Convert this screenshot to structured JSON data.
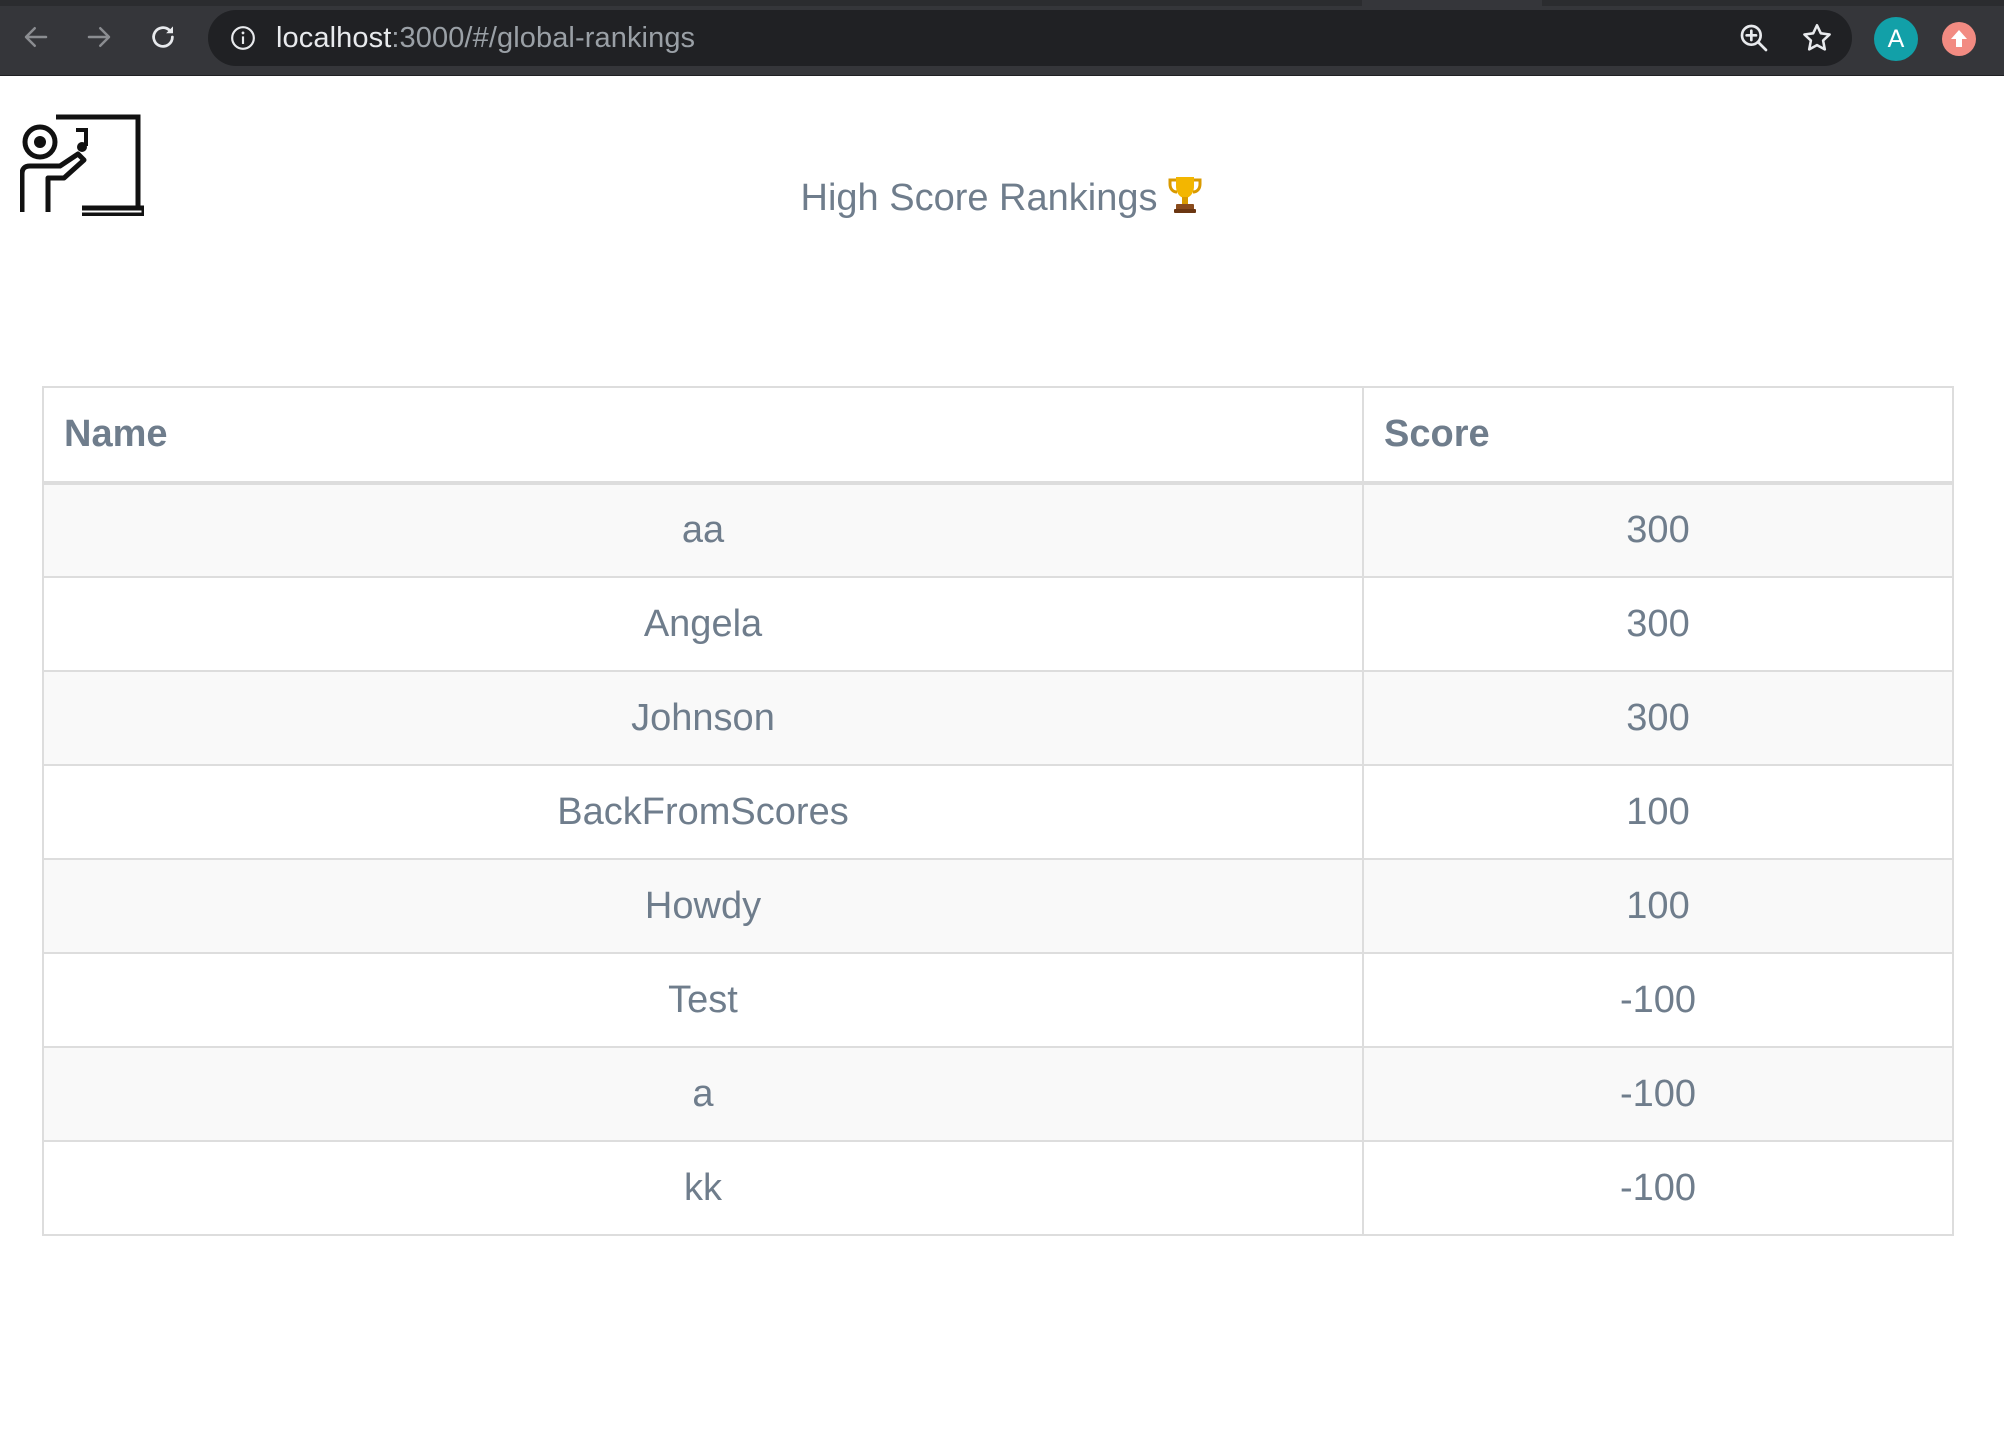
{
  "browser": {
    "url_host": "localhost",
    "url_path": ":3000/#/global-rankings",
    "avatar_letter": "A",
    "icons": [
      "back-arrow-icon",
      "forward-arrow-icon",
      "reload-icon",
      "info-icon",
      "zoom-icon",
      "star-icon",
      "update-icon"
    ]
  },
  "page": {
    "title": "High Score Rankings",
    "title_emoji": "trophy-icon",
    "logo": "teacher-at-board-icon"
  },
  "table": {
    "headers": {
      "name": "Name",
      "score": "Score"
    },
    "rows": [
      {
        "name": "aa",
        "score": "300"
      },
      {
        "name": "Angela",
        "score": "300"
      },
      {
        "name": "Johnson",
        "score": "300"
      },
      {
        "name": "BackFromScores",
        "score": "100"
      },
      {
        "name": "Howdy",
        "score": "100"
      },
      {
        "name": "Test",
        "score": "-100"
      },
      {
        "name": "a",
        "score": "-100"
      },
      {
        "name": "kk",
        "score": "-100"
      }
    ]
  },
  "colors": {
    "text": "#6f7d8c",
    "border": "#dddddd",
    "stripe": "#f9f9f9",
    "avatar": "#12a0a8"
  }
}
